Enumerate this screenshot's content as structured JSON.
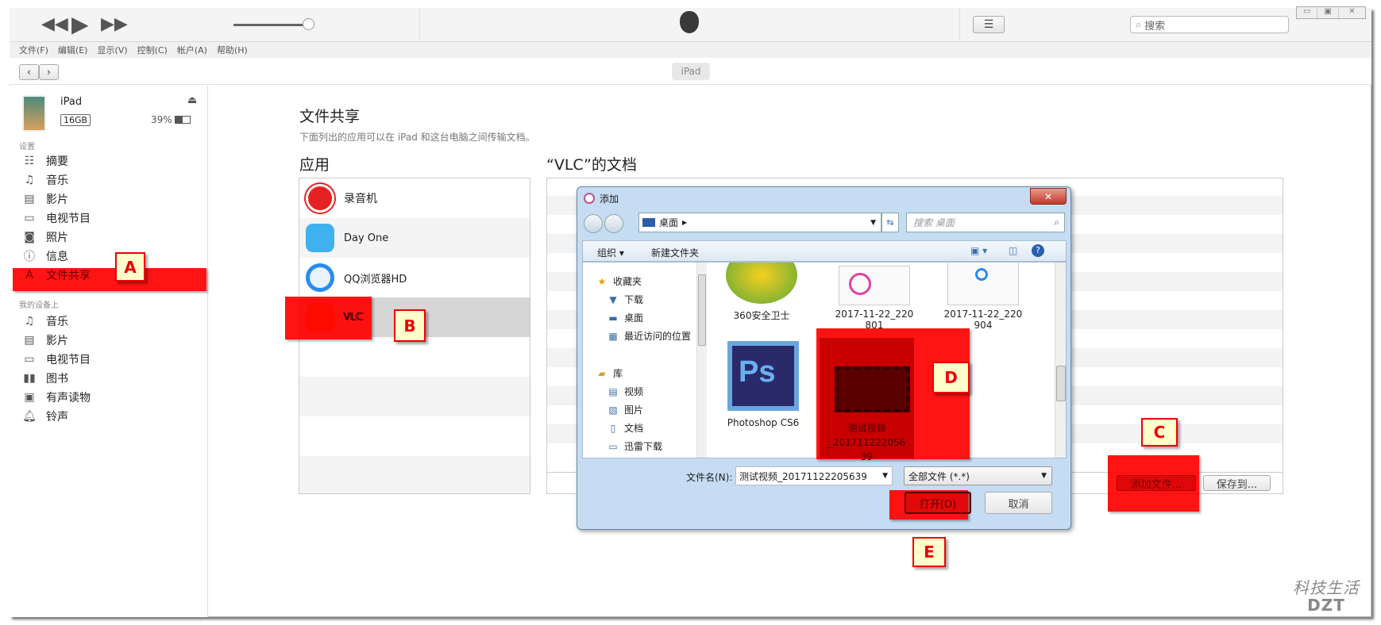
{
  "window": {
    "controls": [
      "minimize",
      "maximize",
      "close"
    ]
  },
  "toolbar": {
    "search_placeholder": "搜索",
    "device_pill": "iPad",
    "volume_percent": 85
  },
  "menu": [
    "文件(F)",
    "编辑(E)",
    "显示(V)",
    "控制(C)",
    "帐户(A)",
    "帮助(H)"
  ],
  "device": {
    "name": "iPad",
    "capacity": "16GB",
    "battery": "39%"
  },
  "sidebar": {
    "settings_header": "设置",
    "settings": [
      "摘要",
      "音乐",
      "影片",
      "电视节目",
      "照片",
      "信息",
      "文件共享"
    ],
    "ondevice_header": "我的设备上",
    "ondevice": [
      "音乐",
      "影片",
      "电视节目",
      "图书",
      "有声读物",
      "铃声"
    ]
  },
  "main": {
    "title": "文件共享",
    "subtitle": "下面列出的应用可以在 iPad 和这台电脑之间传输文档。",
    "apps_heading": "应用",
    "docs_heading": "“VLC”的文档",
    "apps": [
      "录音机",
      "Day One",
      "QQ浏览器HD",
      "VLC"
    ],
    "add_file": "添加文件...",
    "save_to": "保存到..."
  },
  "dialog": {
    "title": "添加",
    "location": "桌面",
    "search_placeholder": "搜索 桌面",
    "organize": "组织",
    "new_folder": "新建文件夹",
    "nav": {
      "favorites": "收藏夹",
      "fav_items": [
        "下载",
        "桌面",
        "最近访问的位置"
      ],
      "library": "库",
      "lib_items": [
        "视频",
        "图片",
        "文档",
        "迅雷下载"
      ]
    },
    "files": {
      "f1": "360安全卫士",
      "f2a": "2017-11-22_220",
      "f2b": "801",
      "f3a": "2017-11-22_220",
      "f3b": "904",
      "f4": "Photoshop CS6",
      "f5a": "测试视频",
      "f5b": "_201711222056",
      "f5c": "39"
    },
    "filename_label": "文件名(N):",
    "filename_value": "测试视频_20171122205639",
    "filter": "全部文件 (*.*)",
    "open": "打开(O)",
    "cancel": "取消"
  },
  "annotations": [
    "A",
    "B",
    "C",
    "D",
    "E"
  ],
  "watermark": "科技生活 DZT",
  "colors": {
    "annotation": "#ff0000",
    "label_bg": "#ffffcc"
  }
}
